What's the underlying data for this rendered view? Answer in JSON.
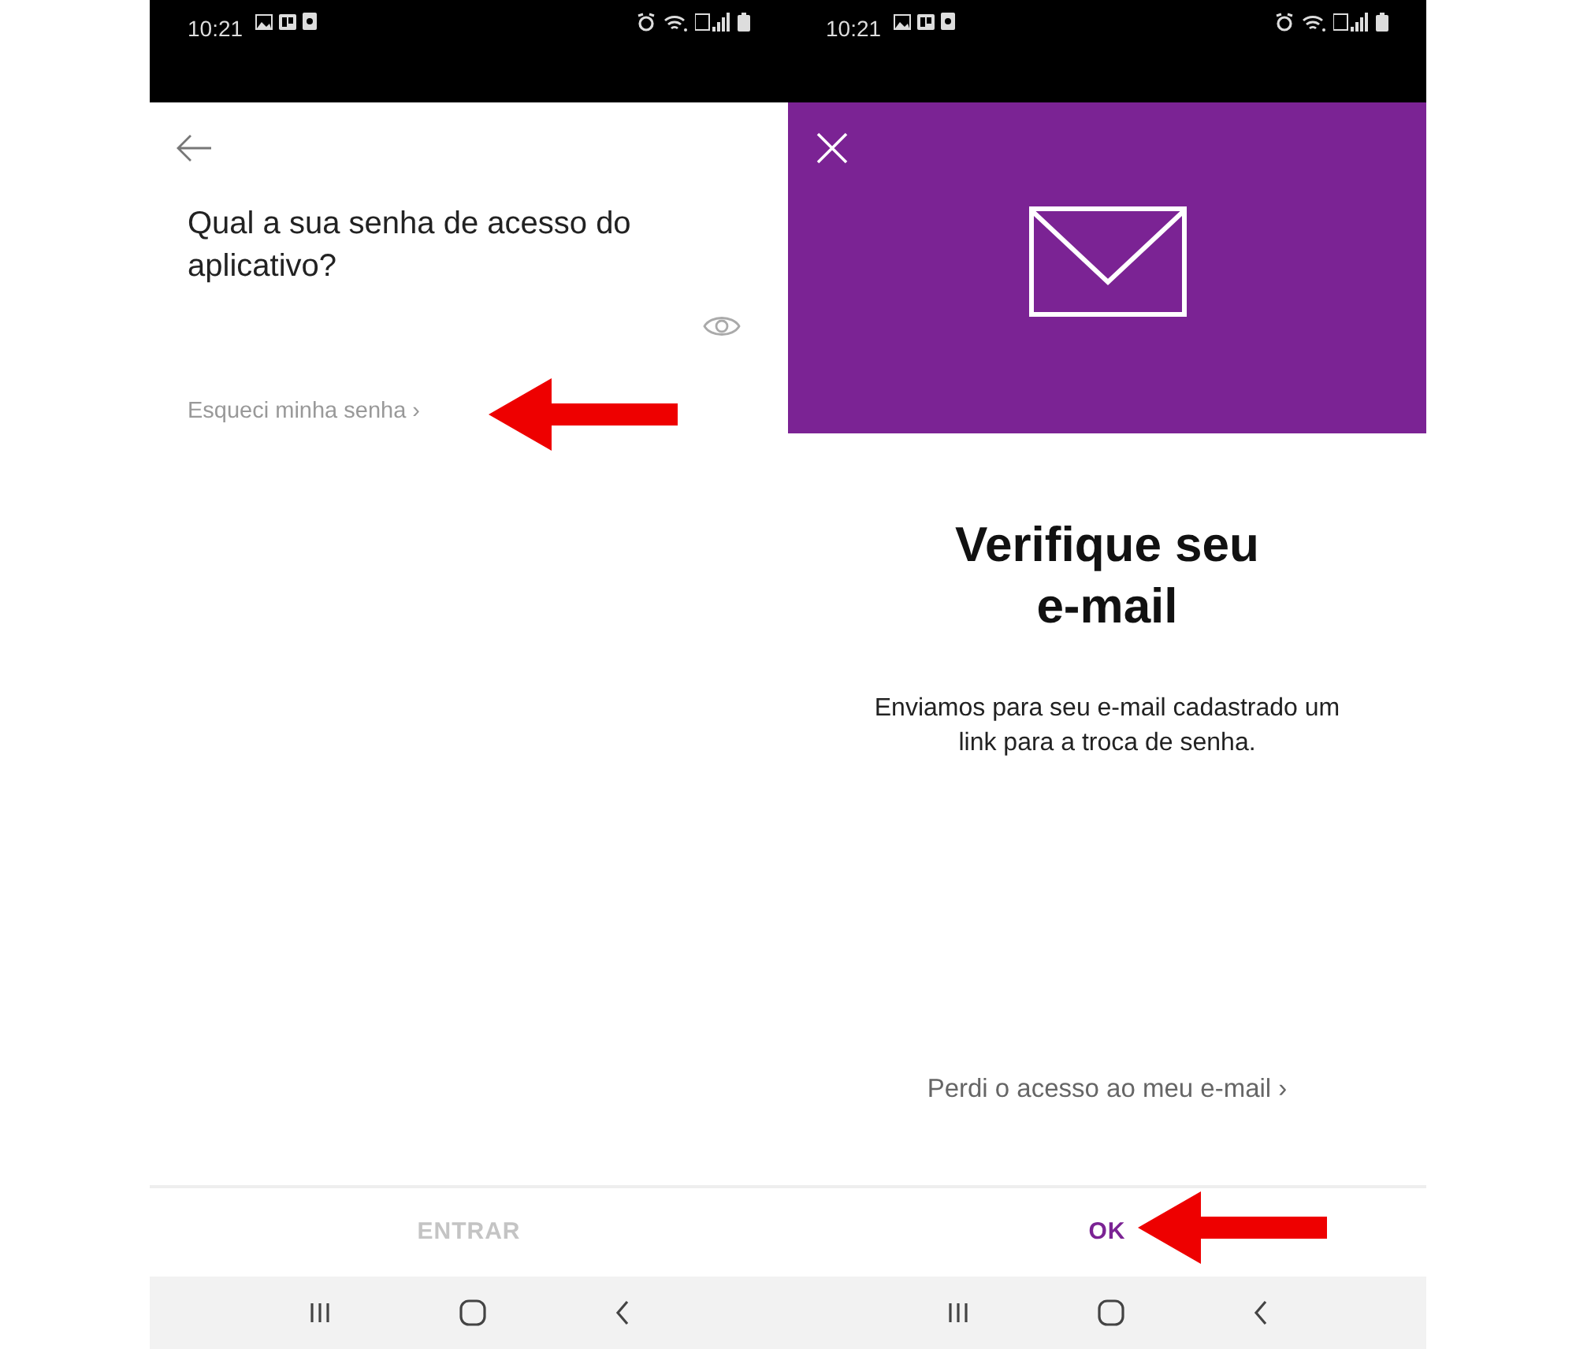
{
  "left_screen": {
    "status_bar": {
      "time": "10:21"
    },
    "question": "Qual a sua senha de acesso do aplicativo?",
    "forgot_link": "Esqueci minha senha ›",
    "button": {
      "label": "ENTRAR",
      "disabled": true
    }
  },
  "right_screen": {
    "status_bar": {
      "time": "10:21"
    },
    "title": "Verifique seu e-mail",
    "message": "Enviamos para seu e-mail cadastrado um link para a troca de senha.",
    "link": "Perdi o acesso ao meu e-mail ›",
    "button": {
      "label": "OK",
      "disabled": false
    }
  }
}
